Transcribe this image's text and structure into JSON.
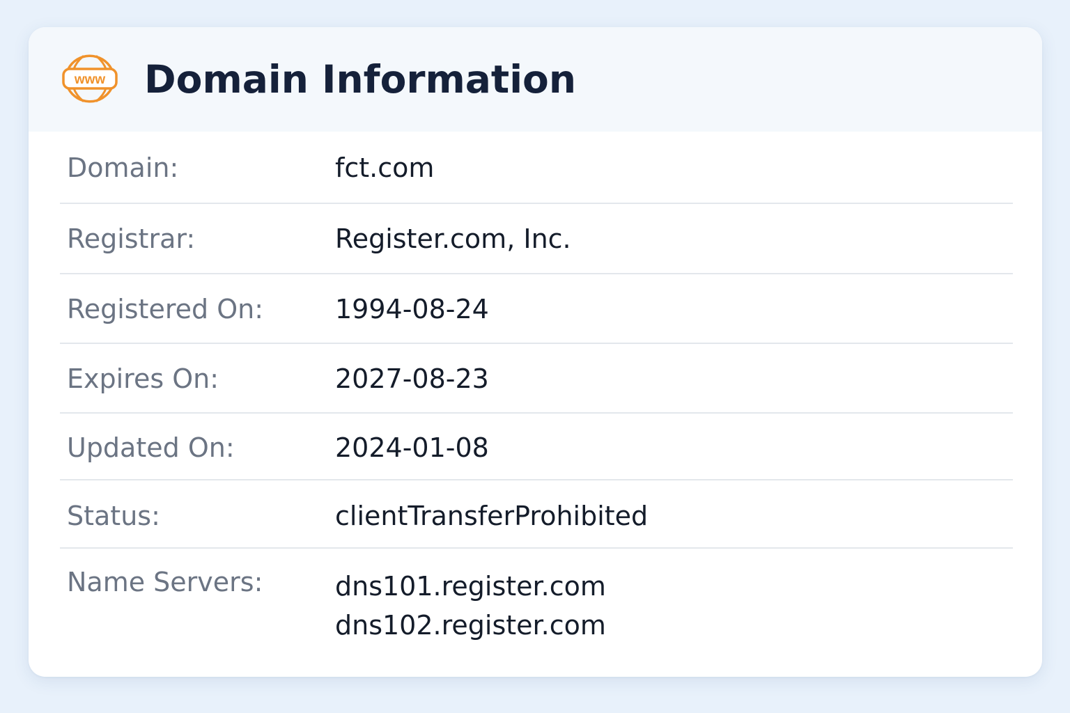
{
  "header": {
    "icon": "www-icon",
    "icon_text": "www",
    "title": "Domain Information"
  },
  "rows": [
    {
      "label": "Domain:",
      "value": "fct.com"
    },
    {
      "label": "Registrar:",
      "value": "Register.com, Inc."
    },
    {
      "label": "Registered On:",
      "value": "1994-08-24"
    },
    {
      "label": "Expires On:",
      "value": "2027-08-23"
    },
    {
      "label": "Updated On:",
      "value": "2024-01-08"
    },
    {
      "label": "Status:",
      "value": "clientTransferProhibited"
    },
    {
      "label": "Name Servers:",
      "values": [
        "dns101.register.com",
        "dns102.register.com"
      ]
    }
  ],
  "colors": {
    "page_background": "#e8f1fb",
    "card_background": "#ffffff",
    "header_background": "#f4f8fc",
    "icon_accent": "#f0922b",
    "title_text": "#15213a",
    "label_text": "#6b7483",
    "value_text": "#141c2a",
    "divider": "#e3e7ec"
  }
}
